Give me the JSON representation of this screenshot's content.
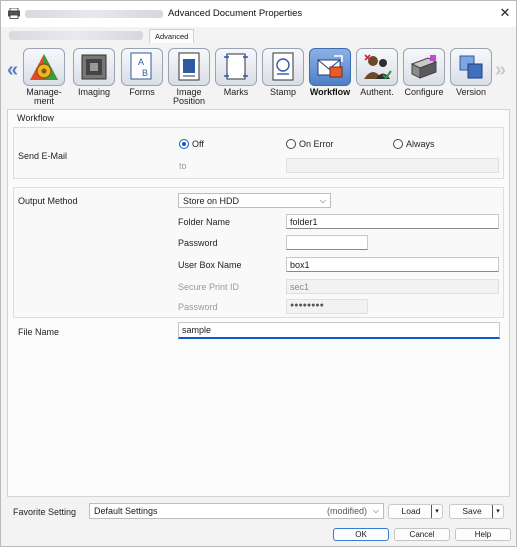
{
  "window": {
    "title": "Advanced Document Properties",
    "close_glyph": "✕",
    "tab_advanced": "Advanced"
  },
  "categories": [
    {
      "label": "Manage-\nment",
      "icon": "management-icon",
      "active": false
    },
    {
      "label": "Imaging",
      "icon": "imaging-icon",
      "active": false
    },
    {
      "label": "Forms",
      "icon": "forms-icon",
      "active": false
    },
    {
      "label": "Image\nPosition",
      "icon": "image-position-icon",
      "active": false
    },
    {
      "label": "Marks",
      "icon": "marks-icon",
      "active": false
    },
    {
      "label": "Stamp",
      "icon": "stamp-icon",
      "active": false
    },
    {
      "label": "Workflow",
      "icon": "workflow-icon",
      "active": true
    },
    {
      "label": "Authent.",
      "icon": "authentication-icon",
      "active": false
    },
    {
      "label": "Configure",
      "icon": "configure-icon",
      "active": false
    },
    {
      "label": "Version",
      "icon": "version-icon",
      "active": false
    }
  ],
  "workflow": {
    "section_title": "Workflow",
    "send_email_label": "Send E-Mail",
    "send_email_options": [
      {
        "label": "Off",
        "selected": true
      },
      {
        "label": "On Error",
        "selected": false
      },
      {
        "label": "Always",
        "selected": false
      }
    ],
    "to_label": "to",
    "to_value": "",
    "output_method_label": "Output Method",
    "output_method_value": "Store on HDD",
    "folder_name_label": "Folder Name",
    "folder_name_value": "folder1",
    "password_label": "Password",
    "password_value": "",
    "user_box_name_label": "User Box Name",
    "user_box_name_value": "box1",
    "secure_print_id_label": "Secure Print ID",
    "secure_print_id_value": "sec1",
    "secure_password_label": "Password",
    "secure_password_value": "●●●●●●●●",
    "file_name_label": "File Name",
    "file_name_value": "sample"
  },
  "favorite": {
    "label": "Favorite Setting",
    "value": "Default Settings",
    "modified": "(modified)",
    "load_label": "Load",
    "save_label": "Save"
  },
  "footer": {
    "ok_label": "OK",
    "cancel_label": "Cancel",
    "help_label": "Help"
  },
  "colors": {
    "accent": "#0b5cc8",
    "active_tile": "#4f7fc6"
  }
}
